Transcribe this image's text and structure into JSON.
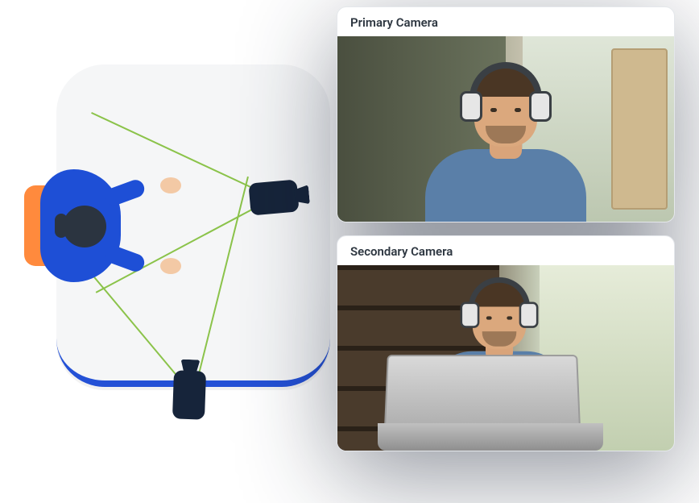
{
  "cameras": {
    "primary": {
      "label": "Primary Camera"
    },
    "secondary": {
      "label": "Secondary Camera"
    }
  }
}
